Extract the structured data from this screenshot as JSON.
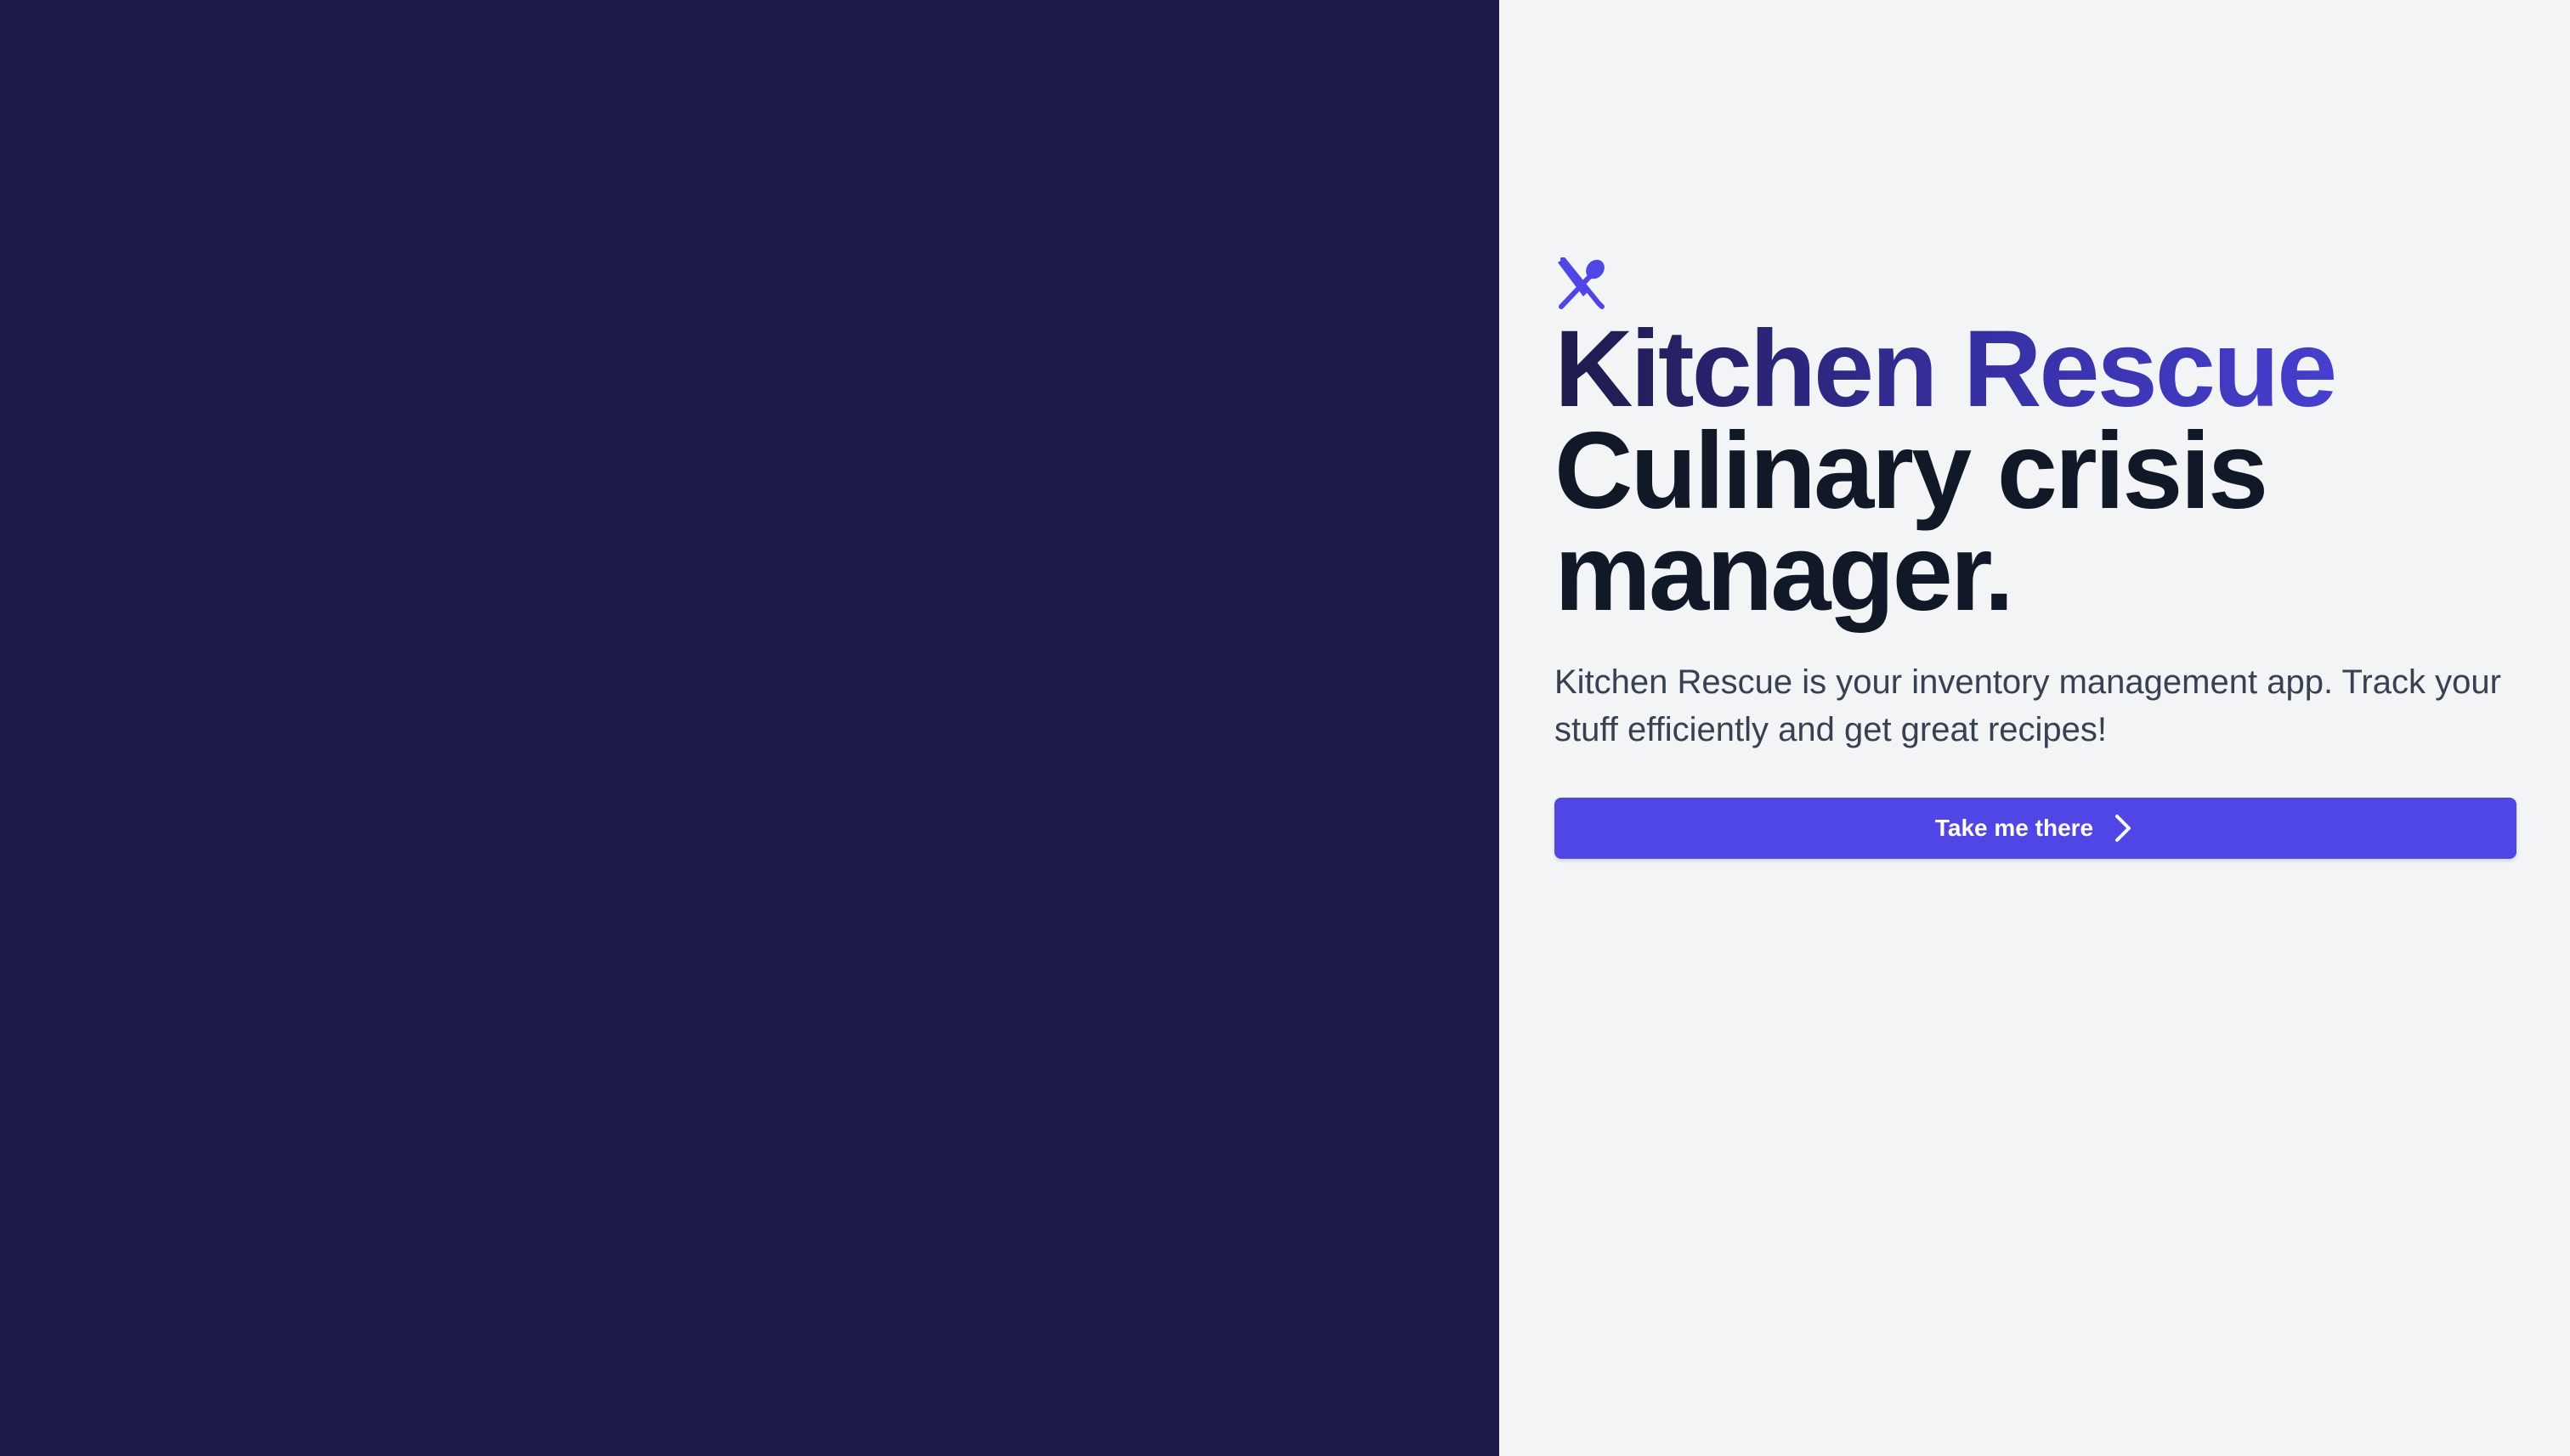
{
  "brand": {
    "logo_icon": "utensils-crossed-icon",
    "name": "Kitchen Rescue",
    "accent_color": "#4f46e5",
    "dark_color": "#1e1b4b"
  },
  "hero": {
    "tagline": "Culinary crisis manager.",
    "description": "Kitchen Rescue is your inventory management app. Track your stuff efficiently and get great recipes!",
    "cta_label": "Take me there",
    "cta_icon": "chevron-right-icon"
  },
  "colors": {
    "left_panel": "#1e1b4b",
    "right_panel": "#f3f4f6",
    "button": "#4f46e5",
    "heading": "#111827",
    "body_text": "#374151"
  }
}
